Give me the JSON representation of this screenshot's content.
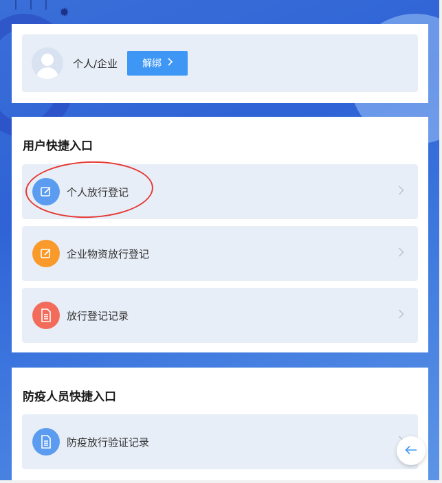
{
  "profile": {
    "name": "个人/企业",
    "unbind_label": "解绑"
  },
  "user_section": {
    "title": "用户快捷入口",
    "items": [
      {
        "label": "个人放行登记",
        "icon": "edit-icon",
        "color": "#5b9cf0"
      },
      {
        "label": "企业物资放行登记",
        "icon": "edit-icon",
        "color": "#f99a2b"
      },
      {
        "label": "放行登记记录",
        "icon": "document-icon",
        "color": "#f26b5b"
      }
    ]
  },
  "epidemic_section": {
    "title": "防疫人员快捷入口",
    "items": [
      {
        "label": "防疫放行验证记录",
        "icon": "document-icon",
        "color": "#5b9cf0"
      }
    ]
  },
  "colors": {
    "accent": "#3f97f5",
    "annotation": "#e53935"
  }
}
